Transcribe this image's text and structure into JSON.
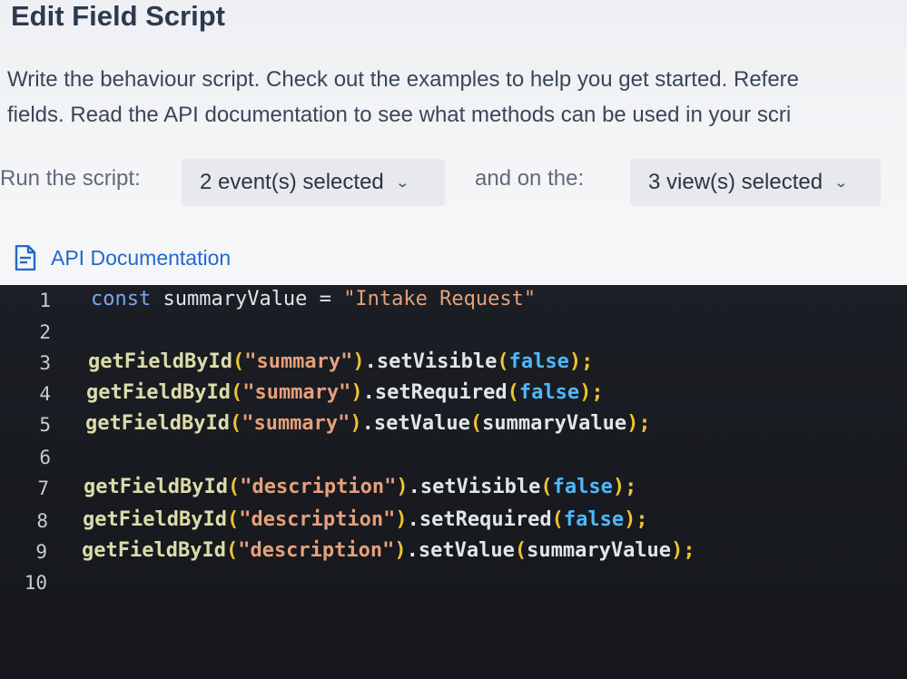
{
  "dialog": {
    "title": "Edit Field Script",
    "description_line1": "Write the behaviour script. Check out the examples to help you get started. Refere",
    "description_line2": "fields. Read the API documentation to see what methods can be used in your scri"
  },
  "run": {
    "label": "Run the script:",
    "events_value": "2 event(s) selected",
    "and_label": "and on the:",
    "views_value": "3 view(s) selected"
  },
  "api_documentation": {
    "label": "API Documentation",
    "icon": "document-icon",
    "color": "#2467cf"
  },
  "editor": {
    "line_numbers": [
      "1",
      "2",
      "3",
      "4",
      "5",
      "6",
      "7",
      "8",
      "9",
      "10"
    ],
    "lines": [
      {
        "kw": "const",
        "name": "summaryValue",
        "op": "=",
        "str": "\"Intake Request\""
      },
      {},
      {
        "fn": "getFieldById",
        "arg": "\"summary\"",
        "method": ".setVisible",
        "val": "false",
        "end": ";"
      },
      {
        "fn": "getFieldById",
        "arg": "\"summary\"",
        "method": ".setRequired",
        "val": "false",
        "end": ";"
      },
      {
        "fn": "getFieldById",
        "arg": "\"summary\"",
        "method": ".setValue",
        "val": "summaryValue",
        "end": ";"
      },
      {},
      {
        "fn": "getFieldById",
        "arg": "\"description\"",
        "method": ".setVisible",
        "val": "false",
        "end": ";"
      },
      {
        "fn": "getFieldById",
        "arg": "\"description\"",
        "method": ".setRequired",
        "val": "false",
        "end": ";"
      },
      {
        "fn": "getFieldById",
        "arg": "\"description\"",
        "method": ".setValue",
        "val": "summaryValue",
        "end": ";"
      },
      {}
    ],
    "paren_open": "(",
    "paren_close": ")"
  }
}
